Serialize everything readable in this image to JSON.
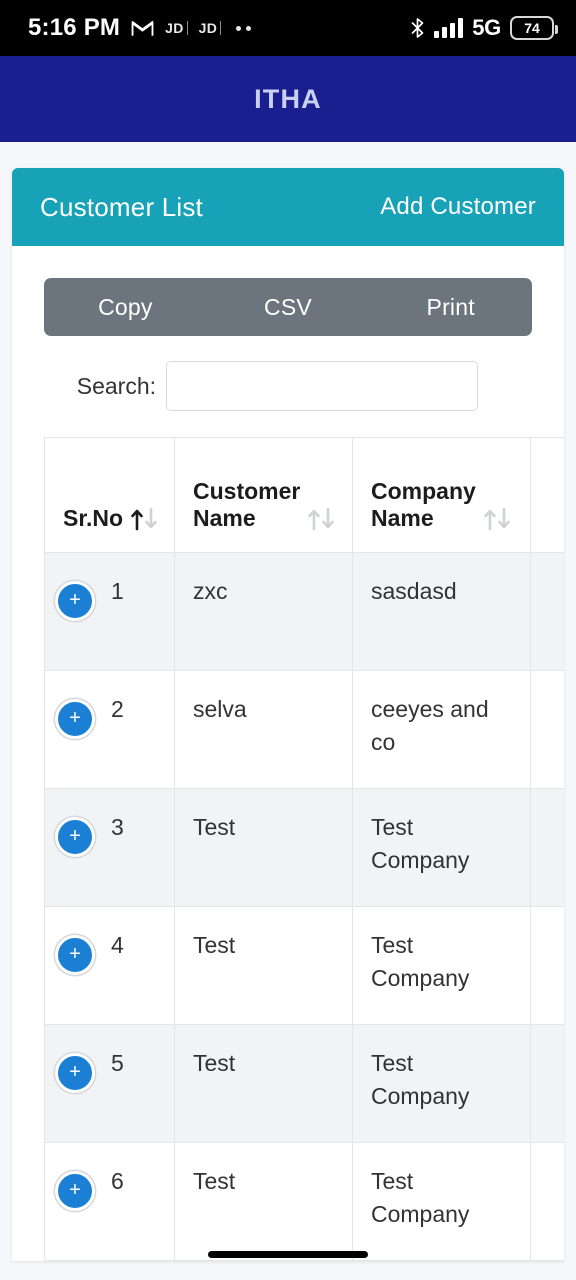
{
  "status_bar": {
    "time": "5:16 PM",
    "gmail_icon": "gmail-icon",
    "app_badges": [
      "JD",
      "JD"
    ],
    "overflow_dots": "..",
    "bluetooth_icon": "bluetooth-icon",
    "signal_icon": "signal-bars-icon",
    "network": "5G",
    "battery_percent": "74"
  },
  "app_bar": {
    "title": "ITHA"
  },
  "card": {
    "title": "Customer List",
    "action_label": "Add Customer"
  },
  "export_buttons": [
    {
      "label": "Copy"
    },
    {
      "label": "CSV"
    },
    {
      "label": "Print"
    }
  ],
  "search": {
    "label": "Search:",
    "value": "",
    "placeholder": ""
  },
  "table": {
    "columns": [
      {
        "label": "Sr.No",
        "sort": "asc",
        "sort_icon": "sort-ascending-icon"
      },
      {
        "label": "Customer Name",
        "sort": "none",
        "sort_icon": "sort-none-icon"
      },
      {
        "label": "Company Name",
        "sort": "none",
        "sort_icon": "sort-none-icon"
      }
    ],
    "expand_icon": "plus-circle-icon",
    "rows": [
      {
        "sr_no": "1",
        "customer_name": "zxc",
        "company_name": "sasdasd"
      },
      {
        "sr_no": "2",
        "customer_name": "selva",
        "company_name": "ceeyes and co"
      },
      {
        "sr_no": "3",
        "customer_name": "Test",
        "company_name": "Test Company"
      },
      {
        "sr_no": "4",
        "customer_name": "Test",
        "company_name": "Test Company"
      },
      {
        "sr_no": "5",
        "customer_name": "Test",
        "company_name": "Test Company"
      },
      {
        "sr_no": "6",
        "customer_name": "Test",
        "company_name": "Test Company"
      }
    ]
  },
  "colors": {
    "app_bar": "#1a1f8f",
    "card_header": "#17a2b8",
    "export_bar": "#6c757d",
    "expand_button": "#1b7fd4",
    "page_background": "#f6f7fa",
    "row_odd": "#f2f3f4"
  }
}
